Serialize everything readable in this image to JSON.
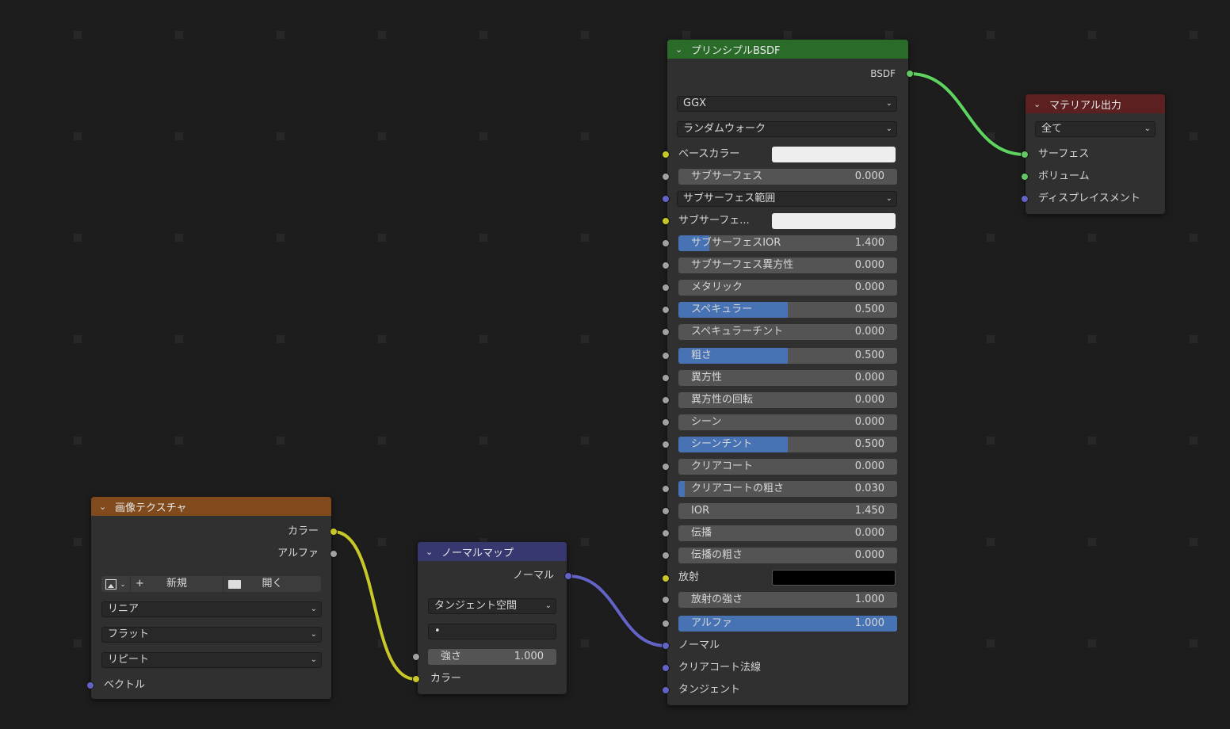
{
  "colors": {
    "bg": "#1d1d1d",
    "node_bg": "#303030",
    "field": "#545454",
    "field_fill": "#4772b3",
    "hdr_shader": "#2a6b2a",
    "hdr_output": "#5c2020",
    "hdr_texture": "#804a1c",
    "hdr_vector": "#383870",
    "sock_yellow": "#c7c729",
    "sock_gray": "#a1a1a1",
    "sock_blue": "#6363c7",
    "sock_green": "#63c763"
  },
  "bsdf": {
    "title": "プリンシプルBSDF",
    "output": "BSDF",
    "distribution": "GGX",
    "subsurface_method": "ランダムウォーク",
    "base_color_label": "ベースカラー",
    "subsurface": {
      "label": "サブサーフェス",
      "value": "0.000",
      "fill": 0
    },
    "subsurface_radius": "サブサーフェス範囲",
    "subsurface_color_label": "サブサーフェ...",
    "subsurface_ior": {
      "label": "サブサーフェスIOR",
      "value": "1.400",
      "fill": 0.14
    },
    "subsurface_anisotropy": {
      "label": "サブサーフェス異方性",
      "value": "0.000",
      "fill": 0
    },
    "metallic": {
      "label": "メタリック",
      "value": "0.000",
      "fill": 0
    },
    "specular": {
      "label": "スペキュラー",
      "value": "0.500",
      "fill": 0.5
    },
    "specular_tint": {
      "label": "スペキュラーチント",
      "value": "0.000",
      "fill": 0
    },
    "roughness": {
      "label": "粗さ",
      "value": "0.500",
      "fill": 0.5
    },
    "anisotropic": {
      "label": "異方性",
      "value": "0.000",
      "fill": 0
    },
    "anisotropic_rotation": {
      "label": "異方性の回転",
      "value": "0.000",
      "fill": 0
    },
    "sheen": {
      "label": "シーン",
      "value": "0.000",
      "fill": 0
    },
    "sheen_tint": {
      "label": "シーンチント",
      "value": "0.500",
      "fill": 0.5
    },
    "clearcoat": {
      "label": "クリアコート",
      "value": "0.000",
      "fill": 0
    },
    "clearcoat_roughness": {
      "label": "クリアコートの粗さ",
      "value": "0.030",
      "fill": 0.03
    },
    "ior": {
      "label": "IOR",
      "value": "1.450",
      "fill": 0
    },
    "transmission": {
      "label": "伝播",
      "value": "0.000",
      "fill": 0
    },
    "transmission_roughness": {
      "label": "伝播の粗さ",
      "value": "0.000",
      "fill": 0
    },
    "emission_label": "放射",
    "emission_strength": {
      "label": "放射の強さ",
      "value": "1.000",
      "fill": 0
    },
    "alpha": {
      "label": "アルファ",
      "value": "1.000",
      "fill": 1
    },
    "normal_label": "ノーマル",
    "clearcoat_normal_label": "クリアコート法線",
    "tangent_label": "タンジェント"
  },
  "output_node": {
    "title": "マテリアル出力",
    "target": "全て",
    "surface": "サーフェス",
    "volume": "ボリューム",
    "displacement": "ディスプレイスメント"
  },
  "texture_node": {
    "title": "画像テクスチャ",
    "color_out": "カラー",
    "alpha_out": "アルファ",
    "new_label": "新規",
    "open_label": "開く",
    "interpolation": "リニア",
    "projection": "フラット",
    "extension": "リピート",
    "vector_label": "ベクトル"
  },
  "normal_map_node": {
    "title": "ノーマルマップ",
    "normal_out": "ノーマル",
    "space": "タンジェント空間",
    "uv_value": "•",
    "strength": {
      "label": "強さ",
      "value": "1.000"
    },
    "color_label": "カラー"
  }
}
